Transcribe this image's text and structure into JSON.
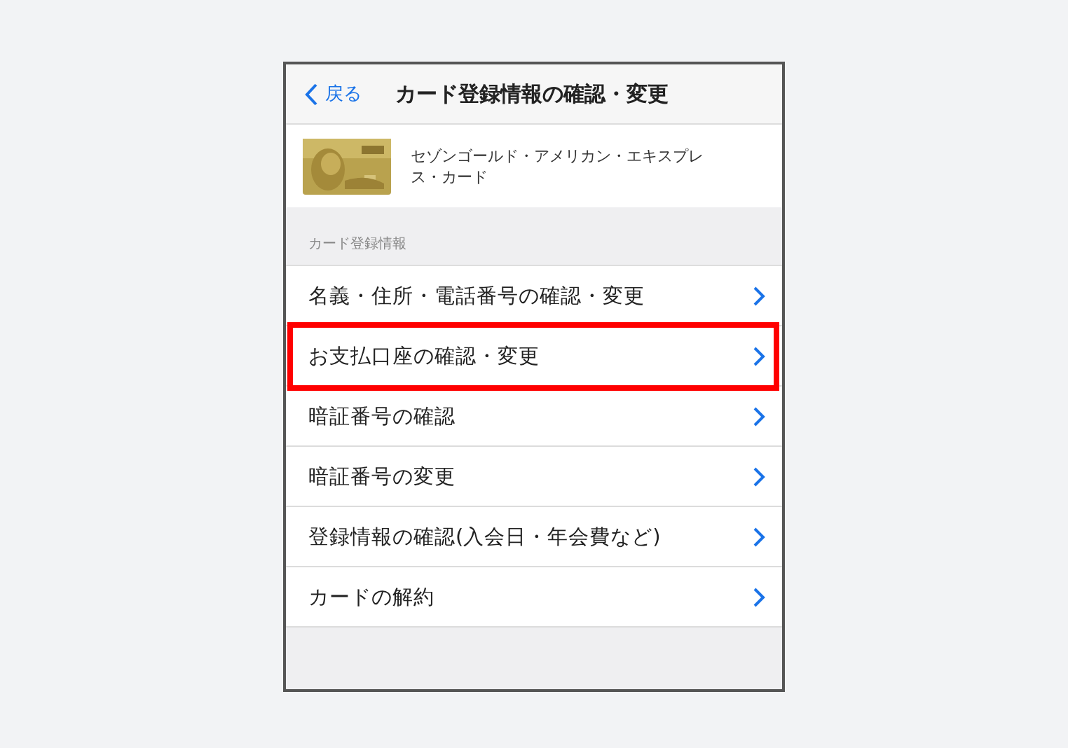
{
  "nav": {
    "back": "戻る",
    "title": "カード登録情報の確認・変更"
  },
  "card": {
    "name": "セゾンゴールド・アメリカン・エキスプレス・カード"
  },
  "section": {
    "label": "カード登録情報"
  },
  "items": [
    {
      "label": "名義・住所・電話番号の確認・変更",
      "highlighted": false
    },
    {
      "label": "お支払口座の確認・変更",
      "highlighted": true
    },
    {
      "label": "暗証番号の確認",
      "highlighted": false
    },
    {
      "label": "暗証番号の変更",
      "highlighted": false
    },
    {
      "label": "登録情報の確認(入会日・年会費など)",
      "highlighted": false
    },
    {
      "label": "カードの解約",
      "highlighted": false
    }
  ]
}
